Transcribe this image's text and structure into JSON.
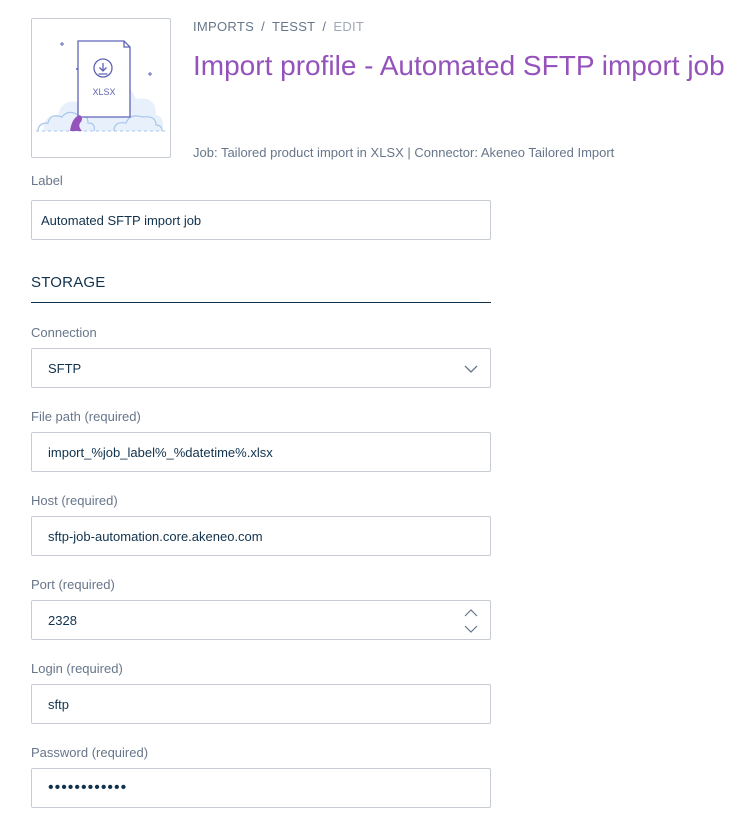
{
  "thumbnail": {
    "file_badge": "XLSX",
    "icons": [
      "download-icon",
      "file-icon",
      "cloud-illustration",
      "sparkle-icon"
    ]
  },
  "breadcrumb": {
    "items": [
      "IMPORTS",
      "TESST",
      "EDIT"
    ],
    "separator": "/"
  },
  "header": {
    "title": "Import profile - Automated SFTP import job",
    "subtitle": "Job: Tailored product import in XLSX | Connector: Akeneo Tailored Import"
  },
  "form": {
    "label": {
      "label": "Label",
      "value": "Automated SFTP import job"
    },
    "storage_section": "STORAGE",
    "connection": {
      "label": "Connection",
      "value": "SFTP"
    },
    "file_path": {
      "label": "File path (required)",
      "value": "import_%job_label%_%datetime%.xlsx"
    },
    "host": {
      "label": "Host (required)",
      "value": "sftp-job-automation.core.akeneo.com"
    },
    "port": {
      "label": "Port (required)",
      "value": "2328"
    },
    "login": {
      "label": "Login (required)",
      "value": "sftp"
    },
    "password": {
      "label": "Password (required)",
      "value": "••••••••••••"
    }
  },
  "colors": {
    "accent": "#9452ba",
    "text": "#11324d",
    "muted": "#67768a",
    "border": "#c7cbd4"
  }
}
